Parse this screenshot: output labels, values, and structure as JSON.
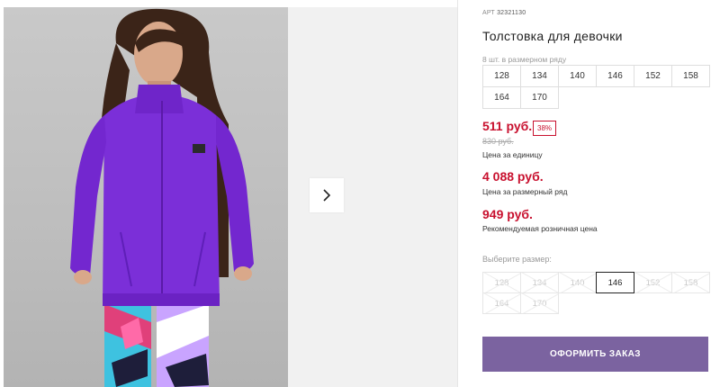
{
  "product": {
    "art_label": "АРТ",
    "art_number": "32321130",
    "title": "Толстовка для девочки",
    "range_label": "8 шт. в размерном ряду",
    "sizes_in_range": [
      "128",
      "134",
      "140",
      "146",
      "152",
      "158",
      "164",
      "170"
    ]
  },
  "pricing": {
    "unit_price": "511 руб.",
    "discount": "38%",
    "old_price": "830 руб.",
    "unit_caption": "Цена за единицу",
    "range_price": "4 088 руб.",
    "range_caption": "Цена за размерный ряд",
    "retail_price": "949 руб.",
    "retail_caption": "Рекомендуемая розничная цена"
  },
  "size_selector": {
    "label": "Выберите размер:",
    "options": [
      "128",
      "134",
      "140",
      "146",
      "152",
      "158",
      "164",
      "170"
    ],
    "selected": "146"
  },
  "actions": {
    "order_button": "ОФОРМИТЬ ЗАКАЗ",
    "next_icon": "chevron-right-icon"
  },
  "colors": {
    "price_red": "#c8102e",
    "button_purple": "#7b63a0",
    "fleece_purple": "#7b2fd8"
  }
}
